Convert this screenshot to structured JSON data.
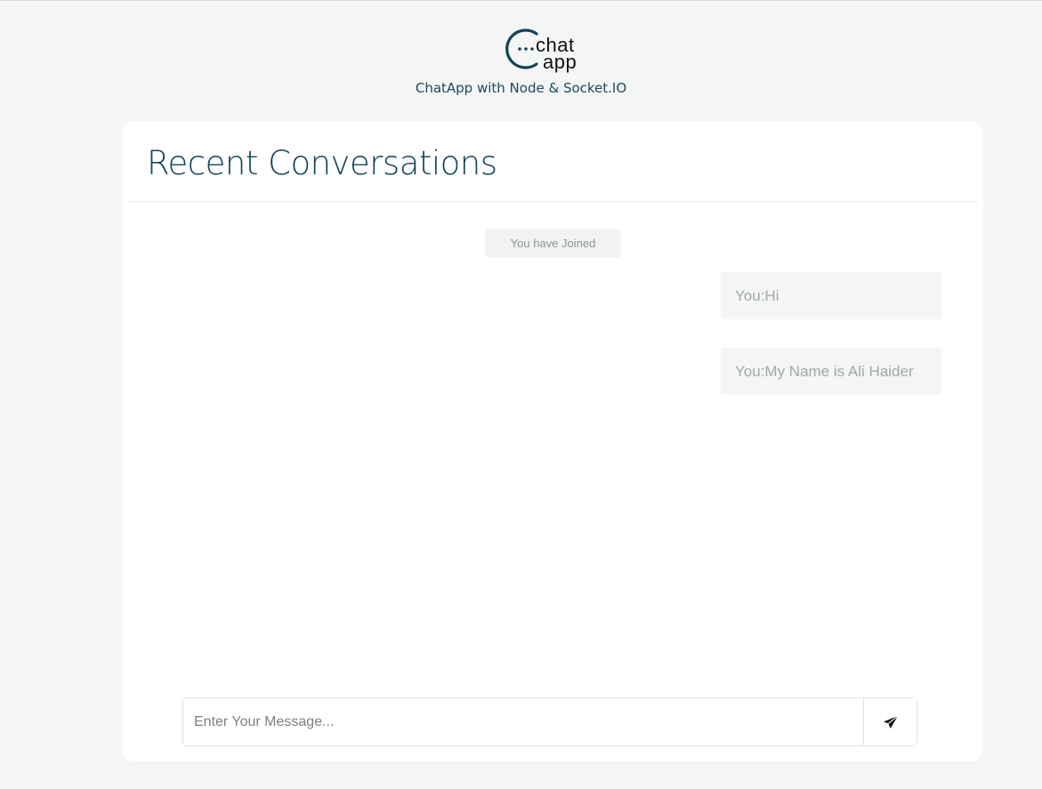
{
  "header": {
    "logo": {
      "word1": "chat",
      "word2": "app",
      "color": "#0f4357"
    },
    "subtitle": "ChatApp with Node & Socket.IO"
  },
  "conversation": {
    "title": "Recent Conversations",
    "system_notice": "You have Joined",
    "messages": [
      {
        "text": "You:Hi"
      },
      {
        "text": "You:My Name is Ali Haider"
      }
    ]
  },
  "composer": {
    "placeholder": "Enter Your Message...",
    "value": "",
    "send_icon": "paper-plane-icon"
  },
  "colors": {
    "accent": "#0f4357",
    "page_background": "#f4f5f5",
    "card_background": "#ffffff"
  }
}
